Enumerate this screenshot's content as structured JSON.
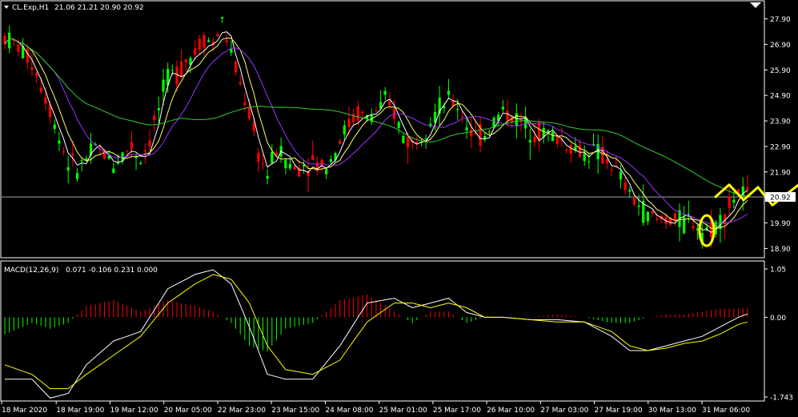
{
  "main_panel": {
    "symbol_label": "CL.Exp,H1",
    "ohlc": "21.06 21.21 20.90 20.92",
    "current_price": "20.92"
  },
  "macd_panel": {
    "label": "MACD(12,26,9)",
    "values": "0.071 -0.106 0.231 0.000"
  },
  "colors": {
    "background": "#000000",
    "bull": "#00ff00",
    "bear": "#ff0000",
    "ma_fast": "#ffffff",
    "ma_mid": "#ffff66",
    "ma_slow": "#9933ff",
    "ma_long": "#33cc33",
    "macd_line": "#ffffff",
    "signal_line": "#ffff00",
    "annotation": "#ffff00",
    "axis": "#ffffff"
  },
  "chart_data": [
    {
      "type": "candlestick",
      "title": "CL.Exp,H1 21.06 21.21 20.90 20.92",
      "ylim": [
        18.6,
        28.2
      ],
      "y_ticks": [
        "27.90",
        "26.90",
        "25.90",
        "24.90",
        "23.90",
        "22.90",
        "21.90",
        "20.92",
        "19.90",
        "18.90"
      ],
      "y_tick_values": [
        27.9,
        26.9,
        25.9,
        24.9,
        23.9,
        22.9,
        21.9,
        20.92,
        19.9,
        18.9
      ],
      "x_tick_labels": [
        "18 Mar 2020",
        "18 Mar 19:00",
        "19 Mar 12:00",
        "20 Mar 05:00",
        "22 Mar 23:00",
        "23 Mar 15:00",
        "24 Mar 08:00",
        "25 Mar 01:00",
        "25 Mar 17:00",
        "26 Mar 10:00",
        "27 Mar 03:00",
        "27 Mar 19:00",
        "30 Mar 13:00",
        "31 Mar 06:00"
      ],
      "price_path": [
        [
          0,
          27.2
        ],
        [
          3,
          26.8
        ],
        [
          6,
          26.2
        ],
        [
          8,
          25.3
        ],
        [
          10,
          24.4
        ],
        [
          12,
          23.2
        ],
        [
          14,
          22.3
        ],
        [
          16,
          22.0
        ],
        [
          18,
          22.4
        ],
        [
          20,
          22.8
        ],
        [
          22,
          22.6
        ],
        [
          24,
          22.2
        ],
        [
          26,
          22.6
        ],
        [
          28,
          22.9
        ],
        [
          30,
          22.4
        ],
        [
          32,
          23.2
        ],
        [
          34,
          24.4
        ],
        [
          36,
          25.6
        ],
        [
          38,
          25.8
        ],
        [
          40,
          26.3
        ],
        [
          42,
          26.6
        ],
        [
          44,
          27.2
        ],
        [
          46,
          26.9
        ],
        [
          48,
          27.8
        ],
        [
          50,
          26.5
        ],
        [
          52,
          25.3
        ],
        [
          54,
          24.2
        ],
        [
          56,
          22.6
        ],
        [
          58,
          21.8
        ],
        [
          60,
          22.8
        ],
        [
          62,
          22.4
        ],
        [
          64,
          22.0
        ],
        [
          66,
          22.2
        ],
        [
          68,
          22.3
        ],
        [
          70,
          22.1
        ],
        [
          72,
          22.4
        ],
        [
          74,
          23.2
        ],
        [
          76,
          23.8
        ],
        [
          78,
          24.2
        ],
        [
          80,
          24.0
        ],
        [
          82,
          24.3
        ],
        [
          84,
          24.6
        ],
        [
          86,
          24.2
        ],
        [
          88,
          23.3
        ],
        [
          90,
          23.0
        ],
        [
          92,
          23.5
        ],
        [
          94,
          24.0
        ],
        [
          96,
          24.4
        ],
        [
          98,
          24.7
        ],
        [
          100,
          24.5
        ],
        [
          102,
          23.8
        ],
        [
          104,
          23.2
        ],
        [
          106,
          23.4
        ],
        [
          108,
          23.9
        ],
        [
          110,
          24.3
        ],
        [
          112,
          24.1
        ],
        [
          114,
          23.8
        ],
        [
          116,
          23.6
        ],
        [
          118,
          23.5
        ],
        [
          120,
          23.4
        ],
        [
          122,
          23.2
        ],
        [
          124,
          23.0
        ],
        [
          126,
          22.8
        ],
        [
          128,
          22.6
        ],
        [
          130,
          22.7
        ],
        [
          132,
          22.5
        ],
        [
          134,
          22.2
        ],
        [
          136,
          21.6
        ],
        [
          138,
          21.0
        ],
        [
          140,
          20.6
        ],
        [
          142,
          20.2
        ],
        [
          144,
          20.0
        ],
        [
          146,
          20.1
        ],
        [
          148,
          20.0
        ],
        [
          150,
          19.9
        ],
        [
          152,
          20.0
        ],
        [
          154,
          19.6
        ],
        [
          156,
          19.7
        ],
        [
          158,
          20.0
        ],
        [
          160,
          20.6
        ],
        [
          162,
          21.1
        ],
        [
          164,
          20.9
        ]
      ],
      "series": [
        {
          "name": "",
          "color": "#ffffff"
        },
        {
          "name": "",
          "color": "#ffff66"
        },
        {
          "name": "",
          "color": "#9933ff"
        },
        {
          "name": "",
          "color": "#33cc33"
        }
      ],
      "annotations": {
        "ellipse_at_index": 155,
        "forecast_zigzag": [
          [
            20.9
          ],
          [
            21.4
          ],
          [
            20.8
          ],
          [
            21.3
          ],
          [
            20.6
          ],
          [
            22.5
          ]
        ]
      }
    },
    {
      "type": "macd",
      "title": "MACD(12,26,9) 0.071 -0.106 0.231 0.000",
      "ylim": [
        -1.743,
        1.05
      ],
      "y_ticks": [
        "1.05",
        "0.00",
        "-1.743"
      ],
      "y_tick_values": [
        1.05,
        0.0,
        -1.743
      ],
      "macd_path": [
        [
          0,
          -1.3
        ],
        [
          6,
          -1.3
        ],
        [
          10,
          -1.7
        ],
        [
          14,
          -1.6
        ],
        [
          18,
          -1.0
        ],
        [
          24,
          -0.5
        ],
        [
          30,
          -0.3
        ],
        [
          36,
          0.6
        ],
        [
          42,
          0.9
        ],
        [
          46,
          1.0
        ],
        [
          50,
          0.7
        ],
        [
          54,
          -0.2
        ],
        [
          58,
          -1.2
        ],
        [
          62,
          -1.3
        ],
        [
          68,
          -1.3
        ],
        [
          74,
          -0.6
        ],
        [
          80,
          0.3
        ],
        [
          86,
          0.4
        ],
        [
          90,
          0.2
        ],
        [
          94,
          0.3
        ],
        [
          98,
          0.4
        ],
        [
          102,
          0.1
        ],
        [
          106,
          0.0
        ],
        [
          110,
          0.0
        ],
        [
          116,
          -0.05
        ],
        [
          122,
          -0.05
        ],
        [
          128,
          -0.1
        ],
        [
          134,
          -0.4
        ],
        [
          138,
          -0.7
        ],
        [
          142,
          -0.7
        ],
        [
          146,
          -0.6
        ],
        [
          150,
          -0.5
        ],
        [
          154,
          -0.4
        ],
        [
          158,
          -0.2
        ],
        [
          162,
          0.0
        ],
        [
          164,
          0.07
        ]
      ],
      "signal_path": [
        [
          0,
          -1.0
        ],
        [
          6,
          -1.2
        ],
        [
          10,
          -1.5
        ],
        [
          14,
          -1.5
        ],
        [
          18,
          -1.2
        ],
        [
          24,
          -0.8
        ],
        [
          30,
          -0.4
        ],
        [
          36,
          0.3
        ],
        [
          42,
          0.7
        ],
        [
          46,
          0.9
        ],
        [
          50,
          0.8
        ],
        [
          54,
          0.3
        ],
        [
          58,
          -0.6
        ],
        [
          62,
          -1.1
        ],
        [
          68,
          -1.2
        ],
        [
          74,
          -0.9
        ],
        [
          80,
          -0.1
        ],
        [
          86,
          0.3
        ],
        [
          90,
          0.3
        ],
        [
          94,
          0.2
        ],
        [
          98,
          0.3
        ],
        [
          102,
          0.2
        ],
        [
          106,
          0.0
        ],
        [
          110,
          0.0
        ],
        [
          116,
          -0.05
        ],
        [
          122,
          -0.1
        ],
        [
          128,
          -0.1
        ],
        [
          134,
          -0.3
        ],
        [
          138,
          -0.6
        ],
        [
          142,
          -0.7
        ],
        [
          146,
          -0.65
        ],
        [
          150,
          -0.55
        ],
        [
          154,
          -0.5
        ],
        [
          158,
          -0.35
        ],
        [
          162,
          -0.15
        ],
        [
          164,
          -0.1
        ]
      ]
    }
  ]
}
